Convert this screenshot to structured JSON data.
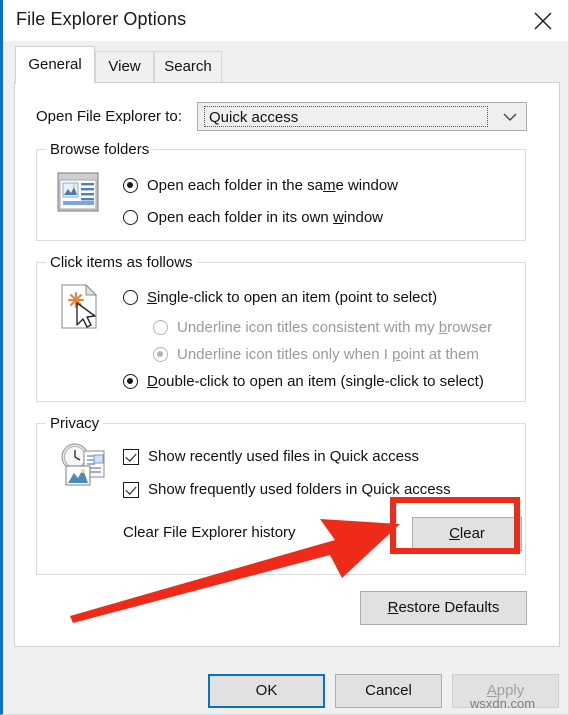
{
  "window": {
    "title": "File Explorer Options",
    "close_icon": "close-icon"
  },
  "tabs": [
    {
      "label": "General",
      "active": true
    },
    {
      "label": "View",
      "active": false
    },
    {
      "label": "Search",
      "active": false
    }
  ],
  "general": {
    "open_to": {
      "label": "Open File Explorer to:",
      "value": "Quick access",
      "arrow_icon": "chevron-down-icon"
    },
    "browse_folders": {
      "title": "Browse folders",
      "icon": "folder-window-icon",
      "options": [
        {
          "label_before": "Open each folder in the sa",
          "accel": "m",
          "label_after": "e window",
          "checked": true
        },
        {
          "label_before": "Open each folder in its own ",
          "accel": "w",
          "label_after": "indow",
          "checked": false
        }
      ]
    },
    "click_items": {
      "title": "Click items as follows",
      "icon": "page-pointer-icon",
      "options": [
        {
          "label_before": "",
          "accel": "S",
          "label_after": "ingle-click to open an item (point to select)",
          "checked": false,
          "disabled": false,
          "indent": false
        },
        {
          "label_before": "Underline icon titles consistent with my ",
          "accel": "b",
          "label_after": "rowser",
          "checked": false,
          "disabled": true,
          "indent": true
        },
        {
          "label_before": "Underline icon titles only when I ",
          "accel": "p",
          "label_after": "oint at them",
          "checked": true,
          "disabled": true,
          "indent": true
        },
        {
          "label_before": "",
          "accel": "D",
          "label_after": "ouble-click to open an item (single-click to select)",
          "checked": true,
          "disabled": false,
          "indent": false
        }
      ]
    },
    "privacy": {
      "title": "Privacy",
      "icon": "clock-documents-icon",
      "checkboxes": [
        {
          "label": "Show recently used files in Quick access",
          "checked": true
        },
        {
          "label": "Show frequently used folders in Quick access",
          "checked": true
        }
      ],
      "clear_history_label": "Clear File Explorer history",
      "clear_button": {
        "label_before": "",
        "accel": "C",
        "label_after": "lear"
      }
    },
    "restore_defaults_button": {
      "label_before": "",
      "accel": "R",
      "label_after": "estore Defaults"
    }
  },
  "footer": {
    "ok_button": "OK",
    "cancel_button": "Cancel",
    "apply_button": {
      "label_before": "",
      "accel": "A",
      "label_after": "pply",
      "disabled": true
    }
  },
  "annotation": {
    "highlight_color": "#ee2a18",
    "arrow_name": "red-arrow-pointing-to-clear-button",
    "watermark": "wsxdn.com"
  }
}
